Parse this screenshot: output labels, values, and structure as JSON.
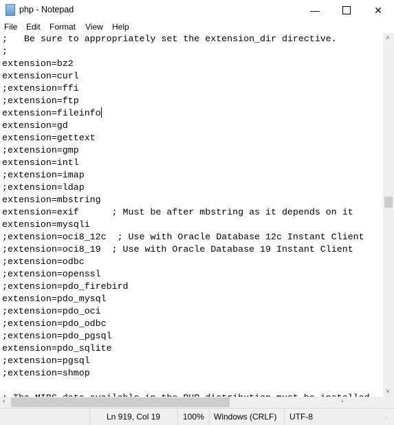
{
  "window": {
    "title": "php - Notepad",
    "app_icon": "notepad-icon"
  },
  "menu": [
    "File",
    "Edit",
    "Format",
    "View",
    "Help"
  ],
  "lines": [
    ";   Be sure to appropriately set the extension_dir directive.",
    ";",
    "extension=bz2",
    "extension=curl",
    ";extension=ffi",
    ";extension=ftp",
    "extension=fileinfo",
    "extension=gd",
    "extension=gettext",
    ";extension=gmp",
    "extension=intl",
    ";extension=imap",
    ";extension=ldap",
    "extension=mbstring",
    "extension=exif      ; Must be after mbstring as it depends on it",
    "extension=mysqli",
    ";extension=oci8_12c  ; Use with Oracle Database 12c Instant Client",
    ";extension=oci8_19  ; Use with Oracle Database 19 Instant Client",
    ";extension=odbc",
    ";extension=openssl",
    ";extension=pdo_firebird",
    "extension=pdo_mysql",
    ";extension=pdo_oci",
    ";extension=pdo_odbc",
    ";extension=pdo_pgsql",
    "extension=pdo_sqlite",
    ";extension=pgsql",
    ";extension=shmop",
    "",
    "; The MIBS data available in the PHP distribution must be installed"
  ],
  "caret_line": 6,
  "status": {
    "position": "Ln 919, Col 19",
    "zoom": "100%",
    "line_ending": "Windows (CRLF)",
    "encoding": "UTF-8"
  }
}
